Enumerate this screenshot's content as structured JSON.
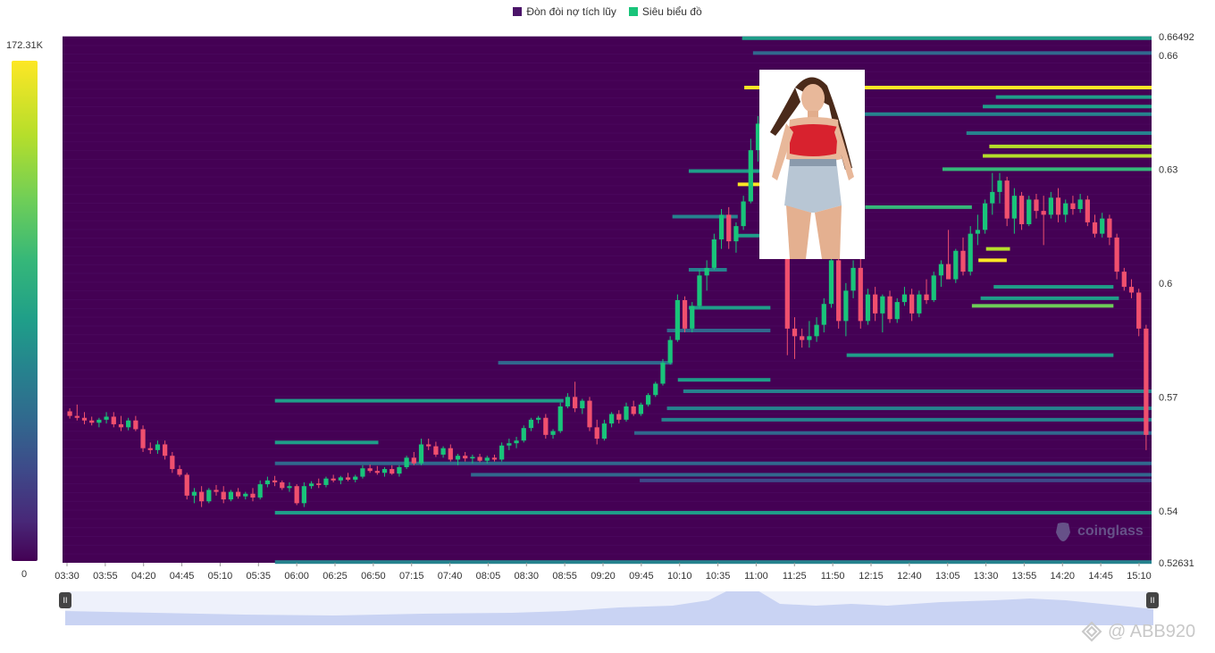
{
  "legend": [
    {
      "label": "Đòn đòi nợ tích lũy",
      "color": "#4b1469"
    },
    {
      "label": "Siêu biểu đồ",
      "color": "#19c47a"
    }
  ],
  "colorbar": {
    "max_label": "172.31K",
    "min_label": "0"
  },
  "watermarks": {
    "coinglass": "coinglass",
    "abb": "@ ABB920"
  },
  "navigator": {
    "left_handle": "II",
    "right_handle": "II"
  },
  "chart_data": {
    "type": "heatmap",
    "price_range": [
      0.52631,
      0.66492
    ],
    "y_ticks": [
      {
        "value": 0.66492,
        "label": "0.66492"
      },
      {
        "value": 0.66,
        "label": "0.66"
      },
      {
        "value": 0.63,
        "label": "0.63"
      },
      {
        "value": 0.6,
        "label": "0.6"
      },
      {
        "value": 0.57,
        "label": "0.57"
      },
      {
        "value": 0.54,
        "label": "0.54"
      },
      {
        "value": 0.52631,
        "label": "0.52631"
      }
    ],
    "x_ticks": [
      "03:30",
      "03:55",
      "04:20",
      "04:45",
      "05:10",
      "05:35",
      "06:00",
      "06:25",
      "06:50",
      "07:15",
      "07:40",
      "08:05",
      "08:30",
      "08:55",
      "09:20",
      "09:45",
      "10:10",
      "10:35",
      "11:00",
      "11:25",
      "11:50",
      "12:15",
      "12:40",
      "13:05",
      "13:30",
      "13:55",
      "14:20",
      "14:45",
      "15:10"
    ],
    "background_color": "#440154",
    "up_color": "#19c47a",
    "down_color": "#f0506e",
    "candles": [
      [
        0.5662,
        0.567,
        0.5643,
        0.565
      ],
      [
        0.565,
        0.568,
        0.5638,
        0.5645
      ],
      [
        0.5645,
        0.566,
        0.5628,
        0.5638
      ],
      [
        0.5638,
        0.5648,
        0.5625,
        0.5632
      ],
      [
        0.5632,
        0.5645,
        0.562,
        0.564
      ],
      [
        0.564,
        0.566,
        0.563,
        0.5648
      ],
      [
        0.5648,
        0.566,
        0.562,
        0.5628
      ],
      [
        0.5628,
        0.565,
        0.561,
        0.562
      ],
      [
        0.562,
        0.5645,
        0.5612,
        0.5638
      ],
      [
        0.5638,
        0.565,
        0.561,
        0.5615
      ],
      [
        0.5615,
        0.5625,
        0.5555,
        0.5565
      ],
      [
        0.5565,
        0.558,
        0.555,
        0.556
      ],
      [
        0.556,
        0.5585,
        0.555,
        0.5575
      ],
      [
        0.5575,
        0.5585,
        0.5535,
        0.5545
      ],
      [
        0.5545,
        0.5555,
        0.55,
        0.551
      ],
      [
        0.551,
        0.552,
        0.549,
        0.5495
      ],
      [
        0.5495,
        0.55,
        0.543,
        0.544
      ],
      [
        0.544,
        0.546,
        0.542,
        0.545
      ],
      [
        0.545,
        0.5465,
        0.541,
        0.5425
      ],
      [
        0.5425,
        0.546,
        0.542,
        0.5455
      ],
      [
        0.5455,
        0.5468,
        0.544,
        0.545
      ],
      [
        0.545,
        0.5465,
        0.542,
        0.543
      ],
      [
        0.543,
        0.5455,
        0.5425,
        0.545
      ],
      [
        0.545,
        0.546,
        0.5432,
        0.5438
      ],
      [
        0.5438,
        0.545,
        0.543,
        0.5445
      ],
      [
        0.5445,
        0.546,
        0.5425,
        0.5435
      ],
      [
        0.5435,
        0.548,
        0.543,
        0.547
      ],
      [
        0.547,
        0.549,
        0.5462,
        0.548
      ],
      [
        0.548,
        0.5492,
        0.5465,
        0.5475
      ],
      [
        0.5475,
        0.548,
        0.5455,
        0.546
      ],
      [
        0.546,
        0.5475,
        0.545,
        0.5465
      ],
      [
        0.5465,
        0.547,
        0.5415,
        0.542
      ],
      [
        0.542,
        0.5475,
        0.541,
        0.5465
      ],
      [
        0.5465,
        0.5478,
        0.5458,
        0.5472
      ],
      [
        0.5472,
        0.5485,
        0.546,
        0.5468
      ],
      [
        0.5468,
        0.549,
        0.5462,
        0.5485
      ],
      [
        0.5485,
        0.5495,
        0.5475,
        0.548
      ],
      [
        0.548,
        0.5492,
        0.547,
        0.5488
      ],
      [
        0.5488,
        0.55,
        0.5478,
        0.5482
      ],
      [
        0.5482,
        0.5495,
        0.5475,
        0.549
      ],
      [
        0.549,
        0.552,
        0.5485,
        0.5512
      ],
      [
        0.5512,
        0.5522,
        0.55,
        0.5505
      ],
      [
        0.5505,
        0.5518,
        0.5495,
        0.55
      ],
      [
        0.55,
        0.5515,
        0.549,
        0.551
      ],
      [
        0.551,
        0.552,
        0.5495,
        0.5498
      ],
      [
        0.5498,
        0.552,
        0.549,
        0.5515
      ],
      [
        0.5515,
        0.5545,
        0.551,
        0.554
      ],
      [
        0.554,
        0.5555,
        0.552,
        0.5525
      ],
      [
        0.5525,
        0.559,
        0.552,
        0.5575
      ],
      [
        0.5575,
        0.559,
        0.556,
        0.557
      ],
      [
        0.557,
        0.5582,
        0.5542,
        0.5548
      ],
      [
        0.5548,
        0.557,
        0.554,
        0.5565
      ],
      [
        0.5565,
        0.5575,
        0.553,
        0.5535
      ],
      [
        0.5535,
        0.555,
        0.552,
        0.5545
      ],
      [
        0.5545,
        0.5555,
        0.553,
        0.5538
      ],
      [
        0.5538,
        0.5548,
        0.5525,
        0.5542
      ],
      [
        0.5542,
        0.555,
        0.5528,
        0.5532
      ],
      [
        0.5532,
        0.5545,
        0.5525,
        0.554
      ],
      [
        0.554,
        0.5548,
        0.553,
        0.5535
      ],
      [
        0.5535,
        0.558,
        0.553,
        0.5572
      ],
      [
        0.5572,
        0.559,
        0.556,
        0.5578
      ],
      [
        0.5578,
        0.5595,
        0.5565,
        0.5585
      ],
      [
        0.5585,
        0.5625,
        0.558,
        0.5618
      ],
      [
        0.5618,
        0.5645,
        0.561,
        0.564
      ],
      [
        0.564,
        0.565,
        0.563,
        0.5645
      ],
      [
        0.5645,
        0.5655,
        0.559,
        0.56
      ],
      [
        0.56,
        0.5615,
        0.559,
        0.561
      ],
      [
        0.561,
        0.5685,
        0.5605,
        0.5675
      ],
      [
        0.5675,
        0.571,
        0.567,
        0.57
      ],
      [
        0.57,
        0.574,
        0.566,
        0.567
      ],
      [
        0.567,
        0.5695,
        0.5655,
        0.569
      ],
      [
        0.569,
        0.57,
        0.561,
        0.562
      ],
      [
        0.562,
        0.564,
        0.5575,
        0.559
      ],
      [
        0.559,
        0.564,
        0.5585,
        0.563
      ],
      [
        0.563,
        0.566,
        0.562,
        0.5655
      ],
      [
        0.5655,
        0.5665,
        0.563,
        0.564
      ],
      [
        0.564,
        0.5685,
        0.5635,
        0.5675
      ],
      [
        0.5675,
        0.569,
        0.565,
        0.5655
      ],
      [
        0.5655,
        0.5685,
        0.565,
        0.568
      ],
      [
        0.568,
        0.571,
        0.5675,
        0.5705
      ],
      [
        0.5705,
        0.574,
        0.57,
        0.5735
      ],
      [
        0.5735,
        0.58,
        0.573,
        0.579
      ],
      [
        0.579,
        0.586,
        0.5785,
        0.585
      ],
      [
        0.585,
        0.597,
        0.5845,
        0.5955
      ],
      [
        0.5955,
        0.5965,
        0.587,
        0.588
      ],
      [
        0.588,
        0.595,
        0.587,
        0.594
      ],
      [
        0.594,
        0.6035,
        0.5935,
        0.602
      ],
      [
        0.602,
        0.606,
        0.598,
        0.604
      ],
      [
        0.604,
        0.613,
        0.6035,
        0.6115
      ],
      [
        0.6115,
        0.6195,
        0.609,
        0.618
      ],
      [
        0.618,
        0.62,
        0.609,
        0.611
      ],
      [
        0.611,
        0.616,
        0.608,
        0.615
      ],
      [
        0.615,
        0.623,
        0.614,
        0.6215
      ],
      [
        0.6215,
        0.638,
        0.621,
        0.635
      ],
      [
        0.635,
        0.644,
        0.632,
        0.642
      ],
      [
        0.642,
        0.652,
        0.64,
        0.647
      ],
      [
        0.647,
        0.648,
        0.633,
        0.6345
      ],
      [
        0.6345,
        0.636,
        0.607,
        0.609
      ],
      [
        0.609,
        0.61,
        0.581,
        0.588
      ],
      [
        0.588,
        0.591,
        0.58,
        0.586
      ],
      [
        0.586,
        0.588,
        0.583,
        0.585
      ],
      [
        0.585,
        0.59,
        0.583,
        0.586
      ],
      [
        0.586,
        0.591,
        0.5845,
        0.589
      ],
      [
        0.589,
        0.596,
        0.587,
        0.5945
      ],
      [
        0.5945,
        0.608,
        0.5935,
        0.606
      ],
      [
        0.606,
        0.61,
        0.588,
        0.59
      ],
      [
        0.59,
        0.6,
        0.586,
        0.598
      ],
      [
        0.598,
        0.606,
        0.596,
        0.604
      ],
      [
        0.604,
        0.611,
        0.588,
        0.59
      ],
      [
        0.59,
        0.5985,
        0.589,
        0.597
      ],
      [
        0.597,
        0.599,
        0.59,
        0.592
      ],
      [
        0.592,
        0.597,
        0.587,
        0.5965
      ],
      [
        0.5965,
        0.598,
        0.5895,
        0.5905
      ],
      [
        0.5905,
        0.596,
        0.5895,
        0.595
      ],
      [
        0.595,
        0.599,
        0.594,
        0.597
      ],
      [
        0.597,
        0.5985,
        0.59,
        0.592
      ],
      [
        0.592,
        0.598,
        0.591,
        0.597
      ],
      [
        0.597,
        0.601,
        0.5945,
        0.5955
      ],
      [
        0.5955,
        0.603,
        0.595,
        0.602
      ],
      [
        0.602,
        0.606,
        0.599,
        0.605
      ],
      [
        0.605,
        0.614,
        0.603,
        0.601
      ],
      [
        0.601,
        0.609,
        0.6,
        0.6085
      ],
      [
        0.6085,
        0.612,
        0.602,
        0.603
      ],
      [
        0.603,
        0.615,
        0.602,
        0.613
      ],
      [
        0.613,
        0.618,
        0.61,
        0.614
      ],
      [
        0.614,
        0.622,
        0.613,
        0.621
      ],
      [
        0.621,
        0.629,
        0.618,
        0.624
      ],
      [
        0.624,
        0.629,
        0.621,
        0.627
      ],
      [
        0.627,
        0.628,
        0.615,
        0.617
      ],
      [
        0.617,
        0.625,
        0.613,
        0.623
      ],
      [
        0.623,
        0.624,
        0.614,
        0.6155
      ],
      [
        0.6155,
        0.623,
        0.615,
        0.622
      ],
      [
        0.622,
        0.6235,
        0.617,
        0.619
      ],
      [
        0.619,
        0.623,
        0.61,
        0.618
      ],
      [
        0.618,
        0.624,
        0.617,
        0.6225
      ],
      [
        0.6225,
        0.625,
        0.616,
        0.618
      ],
      [
        0.618,
        0.622,
        0.616,
        0.621
      ],
      [
        0.621,
        0.623,
        0.618,
        0.6195
      ],
      [
        0.6195,
        0.6235,
        0.6185,
        0.622
      ],
      [
        0.622,
        0.623,
        0.615,
        0.616
      ],
      [
        0.616,
        0.618,
        0.612,
        0.613
      ],
      [
        0.613,
        0.6185,
        0.612,
        0.617
      ],
      [
        0.617,
        0.618,
        0.61,
        0.612
      ],
      [
        0.612,
        0.613,
        0.601,
        0.603
      ],
      [
        0.603,
        0.604,
        0.598,
        0.599
      ],
      [
        0.599,
        0.601,
        0.596,
        0.5975
      ],
      [
        0.5975,
        0.5985,
        0.586,
        0.588
      ],
      [
        0.588,
        0.589,
        0.556,
        0.56
      ]
    ],
    "liquidity_lines": [
      {
        "price": 0.6645,
        "x0": 0.624,
        "x1": 1.0,
        "level": 0.55
      },
      {
        "price": 0.6606,
        "x0": 0.634,
        "x1": 1.0,
        "level": 0.3
      },
      {
        "price": 0.6515,
        "x0": 0.626,
        "x1": 1.0,
        "level": 1.0
      },
      {
        "price": 0.649,
        "x0": 0.857,
        "x1": 1.0,
        "level": 0.48
      },
      {
        "price": 0.6465,
        "x0": 0.845,
        "x1": 1.0,
        "level": 0.52
      },
      {
        "price": 0.6445,
        "x0": 0.645,
        "x1": 1.0,
        "level": 0.4
      },
      {
        "price": 0.6395,
        "x0": 0.83,
        "x1": 1.0,
        "level": 0.42
      },
      {
        "price": 0.636,
        "x0": 0.851,
        "x1": 1.0,
        "level": 0.88
      },
      {
        "price": 0.6335,
        "x0": 0.845,
        "x1": 1.0,
        "level": 0.82
      },
      {
        "price": 0.63,
        "x0": 0.808,
        "x1": 1.0,
        "level": 0.6
      },
      {
        "price": 0.6295,
        "x0": 0.575,
        "x1": 0.65,
        "level": 0.45
      },
      {
        "price": 0.62,
        "x0": 0.737,
        "x1": 0.835,
        "level": 0.62
      },
      {
        "price": 0.626,
        "x0": 0.62,
        "x1": 0.646,
        "level": 1.0
      },
      {
        "price": 0.6175,
        "x0": 0.56,
        "x1": 0.62,
        "level": 0.42
      },
      {
        "price": 0.6125,
        "x0": 0.62,
        "x1": 0.65,
        "level": 0.55
      },
      {
        "price": 0.609,
        "x0": 0.848,
        "x1": 0.87,
        "level": 0.92
      },
      {
        "price": 0.606,
        "x0": 0.841,
        "x1": 0.867,
        "level": 1.0
      },
      {
        "price": 0.6035,
        "x0": 0.575,
        "x1": 0.61,
        "level": 0.35
      },
      {
        "price": 0.599,
        "x0": 0.855,
        "x1": 0.965,
        "level": 0.55
      },
      {
        "price": 0.596,
        "x0": 0.843,
        "x1": 0.97,
        "level": 0.55
      },
      {
        "price": 0.594,
        "x0": 0.835,
        "x1": 0.965,
        "level": 0.8
      },
      {
        "price": 0.5935,
        "x0": 0.575,
        "x1": 0.65,
        "level": 0.45
      },
      {
        "price": 0.5875,
        "x0": 0.555,
        "x1": 0.65,
        "level": 0.3
      },
      {
        "price": 0.581,
        "x0": 0.72,
        "x1": 0.965,
        "level": 0.5
      },
      {
        "price": 0.579,
        "x0": 0.4,
        "x1": 0.56,
        "level": 0.3
      },
      {
        "price": 0.5745,
        "x0": 0.565,
        "x1": 0.65,
        "level": 0.5
      },
      {
        "price": 0.5715,
        "x0": 0.57,
        "x1": 1.0,
        "level": 0.4
      },
      {
        "price": 0.569,
        "x0": 0.195,
        "x1": 0.46,
        "level": 0.48
      },
      {
        "price": 0.567,
        "x0": 0.555,
        "x1": 1.0,
        "level": 0.38
      },
      {
        "price": 0.564,
        "x0": 0.55,
        "x1": 1.0,
        "level": 0.42
      },
      {
        "price": 0.5605,
        "x0": 0.525,
        "x1": 1.0,
        "level": 0.3
      },
      {
        "price": 0.558,
        "x0": 0.195,
        "x1": 0.29,
        "level": 0.48
      },
      {
        "price": 0.5525,
        "x0": 0.195,
        "x1": 1.0,
        "level": 0.2
      },
      {
        "price": 0.5495,
        "x0": 0.375,
        "x1": 1.0,
        "level": 0.22
      },
      {
        "price": 0.548,
        "x0": 0.53,
        "x1": 1.0,
        "level": 0.18
      },
      {
        "price": 0.5395,
        "x0": 0.195,
        "x1": 1.0,
        "level": 0.48
      },
      {
        "price": 0.5265,
        "x0": 0.195,
        "x1": 1.0,
        "level": 0.35
      }
    ]
  }
}
